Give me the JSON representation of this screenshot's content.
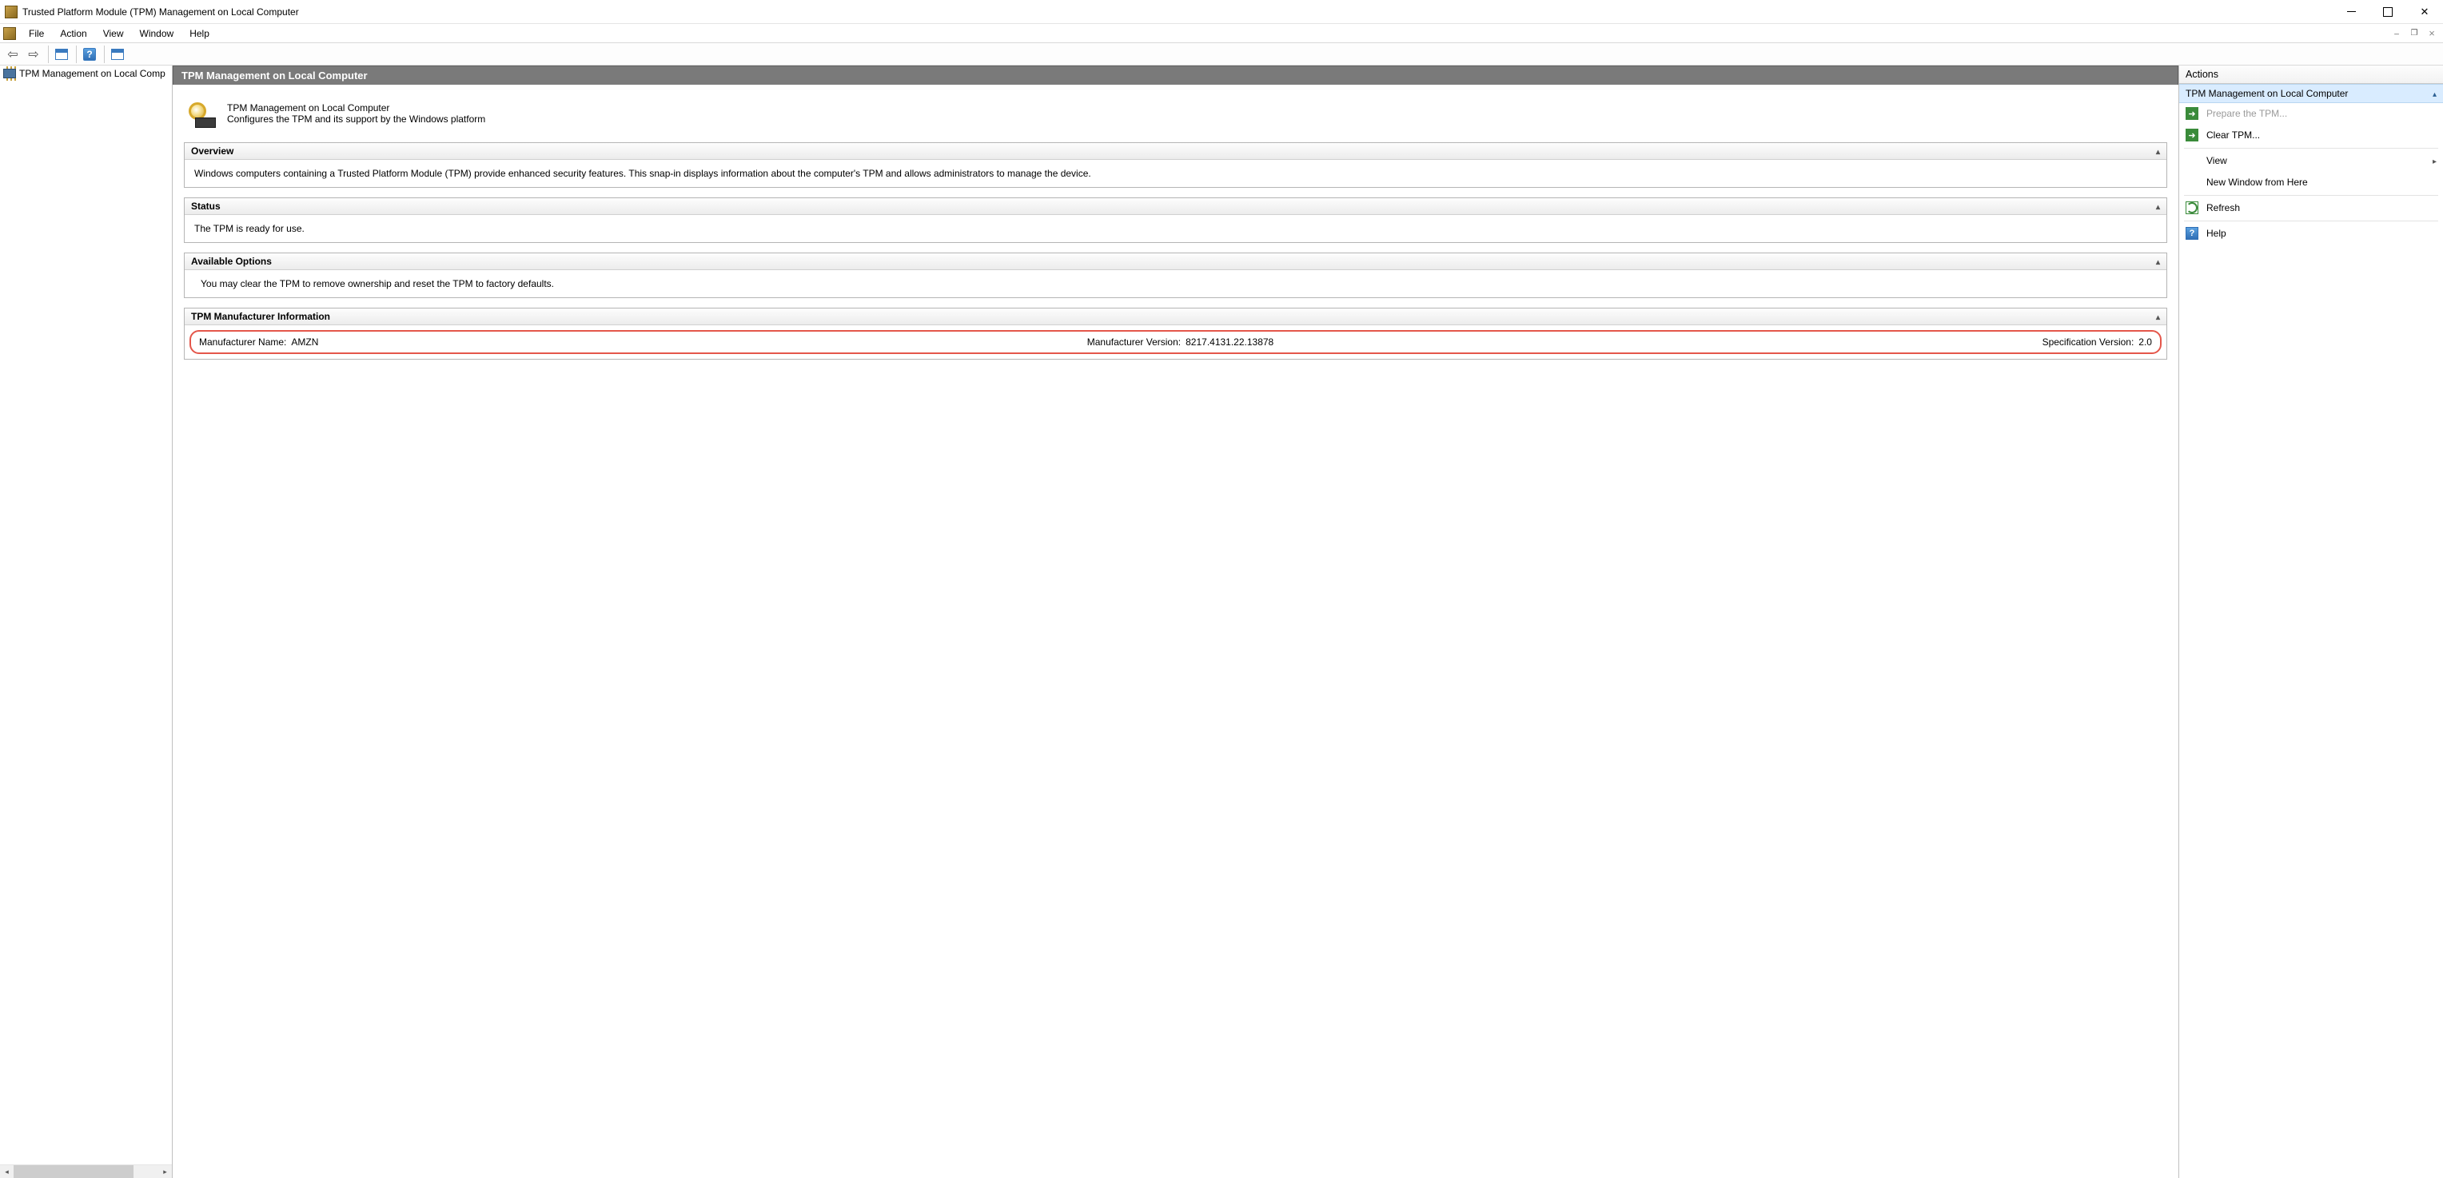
{
  "window": {
    "title": "Trusted Platform Module (TPM) Management on Local Computer"
  },
  "menubar": {
    "file": "File",
    "action": "Action",
    "view": "View",
    "window": "Window",
    "help": "Help"
  },
  "tree": {
    "item0": "TPM Management on Local Comp"
  },
  "content": {
    "header": "TPM Management on Local Computer",
    "introTitle": "TPM Management on Local Computer",
    "introDesc": "Configures the TPM and its support by the Windows platform",
    "overview": {
      "title": "Overview",
      "body": "Windows computers containing a Trusted Platform Module (TPM) provide enhanced security features. This snap-in displays information about the computer's TPM and allows administrators to manage the device."
    },
    "status": {
      "title": "Status",
      "body": "The TPM is ready for use."
    },
    "options": {
      "title": "Available Options",
      "body": "You may clear the TPM to remove ownership and reset the TPM to factory defaults."
    },
    "mfr": {
      "title": "TPM Manufacturer Information",
      "nameLabel": "Manufacturer Name:",
      "nameValue": "AMZN",
      "versionLabel": "Manufacturer Version:",
      "versionValue": "8217.4131.22.13878",
      "specLabel": "Specification Version:",
      "specValue": "2.0"
    }
  },
  "actions": {
    "title": "Actions",
    "subhead": "TPM Management on Local Computer",
    "prepare": "Prepare the TPM...",
    "clear": "Clear TPM...",
    "view": "View",
    "newwin": "New Window from Here",
    "refresh": "Refresh",
    "help": "Help"
  }
}
